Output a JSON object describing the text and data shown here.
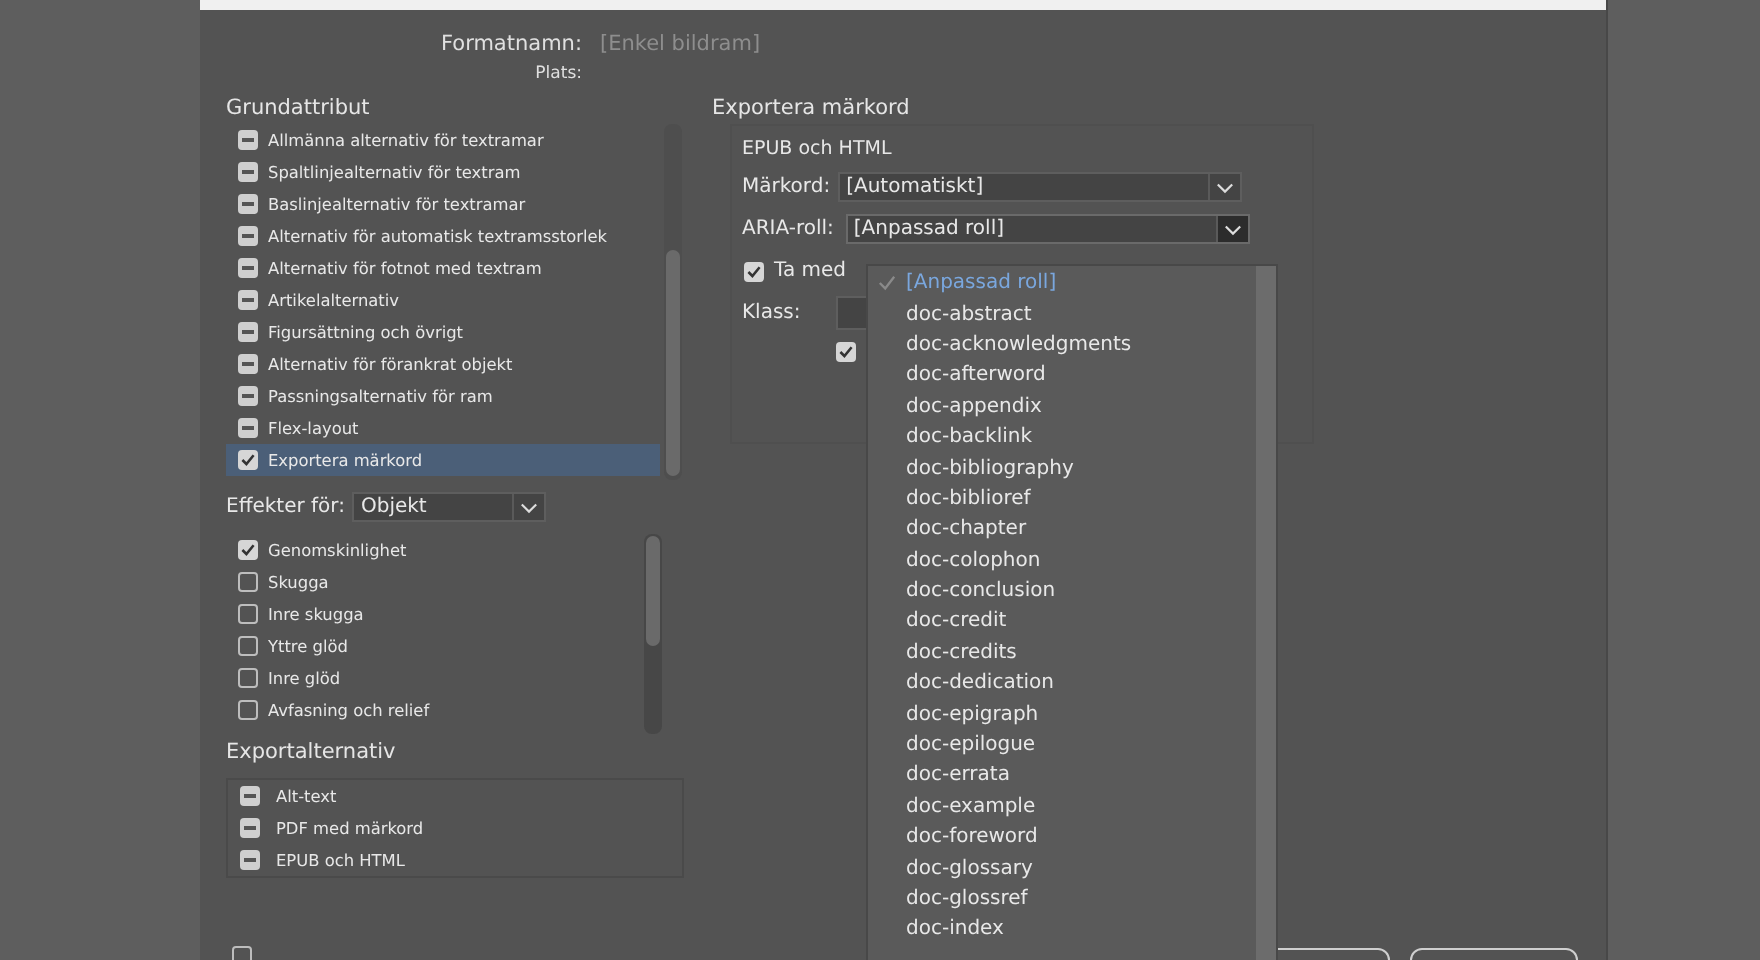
{
  "format_name": {
    "label": "Formatnamn:",
    "placeholder": "[Enkel bildram]"
  },
  "location": {
    "label": "Plats:"
  },
  "basic_attributes": {
    "title": "Grundattribut",
    "items": [
      {
        "label": "Allmänna alternativ för textramar",
        "kind": "ignored",
        "selected": false
      },
      {
        "label": "Spaltlinjealternativ för textram",
        "kind": "ignored",
        "selected": false
      },
      {
        "label": "Baslinjealternativ för textramar",
        "kind": "ignored",
        "selected": false
      },
      {
        "label": "Alternativ för automatisk textramsstorlek",
        "kind": "ignored",
        "selected": false
      },
      {
        "label": "Alternativ för fotnot med textram",
        "kind": "ignored",
        "selected": false
      },
      {
        "label": "Artikelalternativ",
        "kind": "ignored",
        "selected": false
      },
      {
        "label": "Figursättning och övrigt",
        "kind": "ignored",
        "selected": false
      },
      {
        "label": "Alternativ för förankrat objekt",
        "kind": "ignored",
        "selected": false
      },
      {
        "label": "Passningsalternativ för ram",
        "kind": "ignored",
        "selected": false
      },
      {
        "label": "Flex-layout",
        "kind": "ignored",
        "selected": false
      },
      {
        "label": "Exportera märkord",
        "kind": "checkbox",
        "checked": true,
        "selected": true
      }
    ]
  },
  "effects": {
    "label": "Effekter för:",
    "value": "Objekt",
    "items": [
      {
        "label": "Genomskinlighet",
        "checked": true
      },
      {
        "label": "Skugga",
        "checked": false
      },
      {
        "label": "Inre skugga",
        "checked": false
      },
      {
        "label": "Yttre glöd",
        "checked": false
      },
      {
        "label": "Inre glöd",
        "checked": false
      },
      {
        "label": "Avfasning och relief",
        "checked": false
      }
    ]
  },
  "export_options": {
    "title": "Exportalternativ",
    "items": [
      {
        "label": "Alt-text",
        "kind": "ignored"
      },
      {
        "label": "PDF med märkord",
        "kind": "ignored"
      },
      {
        "label": "EPUB och HTML",
        "kind": "ignored"
      }
    ]
  },
  "export_tags": {
    "title": "Exportera märkord",
    "subtitle": "EPUB och HTML",
    "tag": {
      "label": "Märkord:",
      "value": "[Automatiskt]"
    },
    "aria_role": {
      "label": "ARIA-roll:",
      "value": "[Anpassad roll]",
      "expanded": true
    },
    "include": {
      "label": "Ta med",
      "checked": true
    },
    "class": {
      "label": "Klass:"
    },
    "option": {
      "checked": true
    }
  },
  "aria_menu": [
    {
      "label": "[Anpassad roll]",
      "selected": true
    },
    {
      "label": "doc-abstract",
      "selected": false
    },
    {
      "label": "doc-acknowledgments",
      "selected": false
    },
    {
      "label": "doc-afterword",
      "selected": false
    },
    {
      "label": "doc-appendix",
      "selected": false
    },
    {
      "label": "doc-backlink",
      "selected": false
    },
    {
      "label": "doc-bibliography",
      "selected": false
    },
    {
      "label": "doc-biblioref",
      "selected": false
    },
    {
      "label": "doc-chapter",
      "selected": false
    },
    {
      "label": "doc-colophon",
      "selected": false
    },
    {
      "label": "doc-conclusion",
      "selected": false
    },
    {
      "label": "doc-credit",
      "selected": false
    },
    {
      "label": "doc-credits",
      "selected": false
    },
    {
      "label": "doc-dedication",
      "selected": false
    },
    {
      "label": "doc-epigraph",
      "selected": false
    },
    {
      "label": "doc-epilogue",
      "selected": false
    },
    {
      "label": "doc-errata",
      "selected": false
    },
    {
      "label": "doc-example",
      "selected": false
    },
    {
      "label": "doc-foreword",
      "selected": false
    },
    {
      "label": "doc-glossary",
      "selected": false
    },
    {
      "label": "doc-glossref",
      "selected": false
    },
    {
      "label": "doc-index",
      "selected": false
    }
  ],
  "preview": {
    "checked": false
  }
}
